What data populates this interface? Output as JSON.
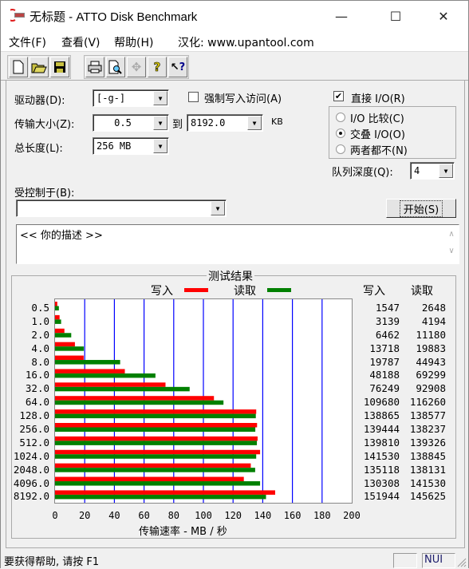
{
  "window": {
    "title": "无标题 - ATTO Disk Benchmark",
    "minimize": "—",
    "maximize": "☐",
    "close": "✕"
  },
  "menu": {
    "file": "文件(F)",
    "view": "查看(V)",
    "help": "帮助(H)",
    "credit": "汉化: www.upantool.com"
  },
  "toolbar": {
    "new": "🗋",
    "open": "📂",
    "save": "💾",
    "print": "🖶",
    "preview": "🔍",
    "move": "✥",
    "help": "?",
    "context_help": "↖?"
  },
  "form": {
    "drive_label": "驱动器(D):",
    "drive_value": "[-g-]",
    "force_write_label": "强制写入访问(A)",
    "force_write_checked": false,
    "direct_io_label": "直接 I/O(R)",
    "direct_io_checked": true,
    "transfer_size_label": "传输大小(Z):",
    "transfer_from": "0.5",
    "to_label": "到",
    "transfer_to": "8192.0",
    "kb_label": "KB",
    "total_length_label": "总长度(L):",
    "total_length_value": "256 MB",
    "io_compare_label": "I/O 比较(C)",
    "overlapped_io_label": "交叠 I/O(O)",
    "neither_label": "两者都不(N)",
    "selected_radio": "overlapped",
    "queue_depth_label": "队列深度(Q):",
    "queue_depth_value": "4",
    "controlled_by_label": "受控制于(B):",
    "controlled_by_value": "",
    "start_button": "开始(S)",
    "description": "<<   你的描述    >>"
  },
  "results": {
    "title": "测试结果",
    "write_header": "写入",
    "read_header": "读取"
  },
  "colors": {
    "write": "#ff0000",
    "read": "#008000",
    "grid": "#0000ff"
  },
  "chart_data": {
    "type": "bar",
    "orientation": "horizontal",
    "title": "测试结果",
    "xlabel": "传输速率 - MB / 秒",
    "ylabel": "",
    "xlim": [
      0,
      200
    ],
    "x_ticks": [
      "0",
      "20",
      "40",
      "60",
      "80",
      "100",
      "120",
      "140",
      "160",
      "180",
      "200"
    ],
    "grid": true,
    "legend": "top",
    "categories": [
      "0.5",
      "1.0",
      "2.0",
      "4.0",
      "8.0",
      "16.0",
      "32.0",
      "64.0",
      "128.0",
      "256.0",
      "512.0",
      "1024.0",
      "2048.0",
      "4096.0",
      "8192.0"
    ],
    "series": [
      {
        "name": "写入",
        "values_kbps": [
          1547,
          3139,
          6462,
          13718,
          19787,
          48188,
          76249,
          109680,
          138865,
          139444,
          139810,
          141530,
          135118,
          130308,
          151944
        ]
      },
      {
        "name": "读取",
        "values_kbps": [
          2648,
          4194,
          11180,
          19883,
          44943,
          69299,
          92908,
          116260,
          138577,
          138237,
          139326,
          138845,
          138131,
          141530,
          145625
        ]
      }
    ]
  },
  "status": {
    "help_text": "要获得帮助, 请按 F1",
    "num": "NUI"
  }
}
